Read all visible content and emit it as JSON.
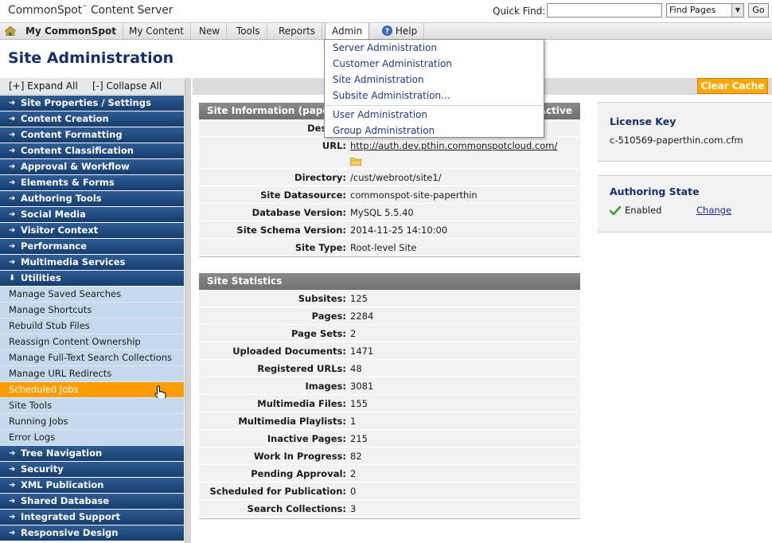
{
  "app": {
    "logo": "CommonSpot",
    "logo_tm": "™",
    "logo_suffix": " Content Server"
  },
  "quick_find": {
    "label": "Quick Find:",
    "value": "",
    "select_value": "Find Pages",
    "go_label": "Go"
  },
  "nav": {
    "items": [
      "My CommonSpot",
      "My Content",
      "New",
      "Tools",
      "Reports",
      "Admin",
      "Help"
    ]
  },
  "admin_menu": {
    "items": [
      "Server Administration",
      "Customer Administration",
      "Site Administration",
      "Subsite Administration...",
      "User Administration",
      "Group Administration"
    ]
  },
  "page": {
    "title": "Site Administration",
    "clear_cache": "Clear Cache"
  },
  "sidebar": {
    "expand_all": "[+] Expand All",
    "collapse_all": "[-] Collapse All",
    "items": [
      {
        "label": "Site Properties / Settings",
        "type": "category",
        "arrow": "➜"
      },
      {
        "label": "Content Creation",
        "type": "category",
        "arrow": "➜"
      },
      {
        "label": "Content Formatting",
        "type": "category",
        "arrow": "➜"
      },
      {
        "label": "Content Classification",
        "type": "category",
        "arrow": "➜"
      },
      {
        "label": "Approval & Workflow",
        "type": "category",
        "arrow": "➜"
      },
      {
        "label": "Elements & Forms",
        "type": "category",
        "arrow": "➜"
      },
      {
        "label": "Authoring Tools",
        "type": "category",
        "arrow": "➜"
      },
      {
        "label": "Social Media",
        "type": "category",
        "arrow": "➜"
      },
      {
        "label": "Visitor Context",
        "type": "category",
        "arrow": "➜"
      },
      {
        "label": "Performance",
        "type": "category",
        "arrow": "➜"
      },
      {
        "label": "Multimedia Services",
        "type": "category",
        "arrow": "➜"
      },
      {
        "label": "Utilities",
        "type": "category",
        "arrow": "⬇"
      },
      {
        "label": "Manage Saved Searches",
        "type": "sub"
      },
      {
        "label": "Manage Shortcuts",
        "type": "sub"
      },
      {
        "label": "Rebuild Stub Files",
        "type": "sub"
      },
      {
        "label": "Reassign Content Ownership",
        "type": "sub"
      },
      {
        "label": "Manage Full-Text Search Collections",
        "type": "sub"
      },
      {
        "label": "Manage URL Redirects",
        "type": "sub"
      },
      {
        "label": "Scheduled Jobs",
        "type": "sub",
        "active": true
      },
      {
        "label": "Site Tools",
        "type": "sub"
      },
      {
        "label": "Running Jobs",
        "type": "sub"
      },
      {
        "label": "Error Logs",
        "type": "sub"
      },
      {
        "label": "Tree Navigation",
        "type": "category",
        "arrow": "➜"
      },
      {
        "label": "Security",
        "type": "category",
        "arrow": "➜"
      },
      {
        "label": "XML Publication",
        "type": "category",
        "arrow": "➜"
      },
      {
        "label": "Shared Database",
        "type": "category",
        "arrow": "➜"
      },
      {
        "label": "Integrated Support",
        "type": "category",
        "arrow": "➜"
      },
      {
        "label": "Responsive Design",
        "type": "category",
        "arrow": "➜"
      }
    ]
  },
  "site_info": {
    "header_left": "Site Information (pape",
    "header_right": "Active",
    "rows": [
      {
        "label": "Descrip",
        "value": ""
      },
      {
        "label": "URL:",
        "value": "http://auth.dev.pthin.commonspotcloud.com/"
      },
      {
        "label": "Directory:",
        "value": "/cust/webroot/site1/"
      },
      {
        "label": "Site Datasource:",
        "value": "commonspot-site-paperthin"
      },
      {
        "label": "Database Version:",
        "value": "MySQL 5.5.40"
      },
      {
        "label": "Site Schema Version:",
        "value": "2014-11-25 14:10:00"
      },
      {
        "label": "Site Type:",
        "value": "Root-level Site"
      }
    ]
  },
  "site_stats": {
    "header": "Site Statistics",
    "rows": [
      {
        "label": "Subsites:",
        "value": "125"
      },
      {
        "label": "Pages:",
        "value": "2284"
      },
      {
        "label": "Page Sets:",
        "value": "2"
      },
      {
        "label": "Uploaded Documents:",
        "value": "1471"
      },
      {
        "label": "Registered URLs:",
        "value": "48"
      },
      {
        "label": "Images:",
        "value": "3081"
      },
      {
        "label": "Multimedia Files:",
        "value": "155"
      },
      {
        "label": "Multimedia Playlists:",
        "value": "1"
      },
      {
        "label": "Inactive Pages:",
        "value": "215"
      },
      {
        "label": "Work In Progress:",
        "value": "82"
      },
      {
        "label": "Pending Approval:",
        "value": "2"
      },
      {
        "label": "Scheduled for Publication:",
        "value": "0"
      },
      {
        "label": "Search Collections:",
        "value": "3"
      }
    ]
  },
  "license": {
    "title": "License Key",
    "value": "c-510569-paperthin.com.cfm"
  },
  "authoring_state": {
    "title": "Authoring State",
    "status": "Enabled",
    "change_label": "Change"
  },
  "colors": {
    "title_blue": "#16306a",
    "category_blue": "#1f4a7e",
    "sub_blue": "#c5d9ec",
    "active_orange": "#ff9d00",
    "panel_gray": "#7a7a7a",
    "link_blue": "#1a2f8a"
  },
  "icons": {
    "home": "home-icon",
    "help": "help-icon",
    "folder": "folder-icon",
    "check": "checkmark-icon",
    "cursor": "hand-cursor-icon",
    "dropdown": "chevron-down-icon"
  }
}
